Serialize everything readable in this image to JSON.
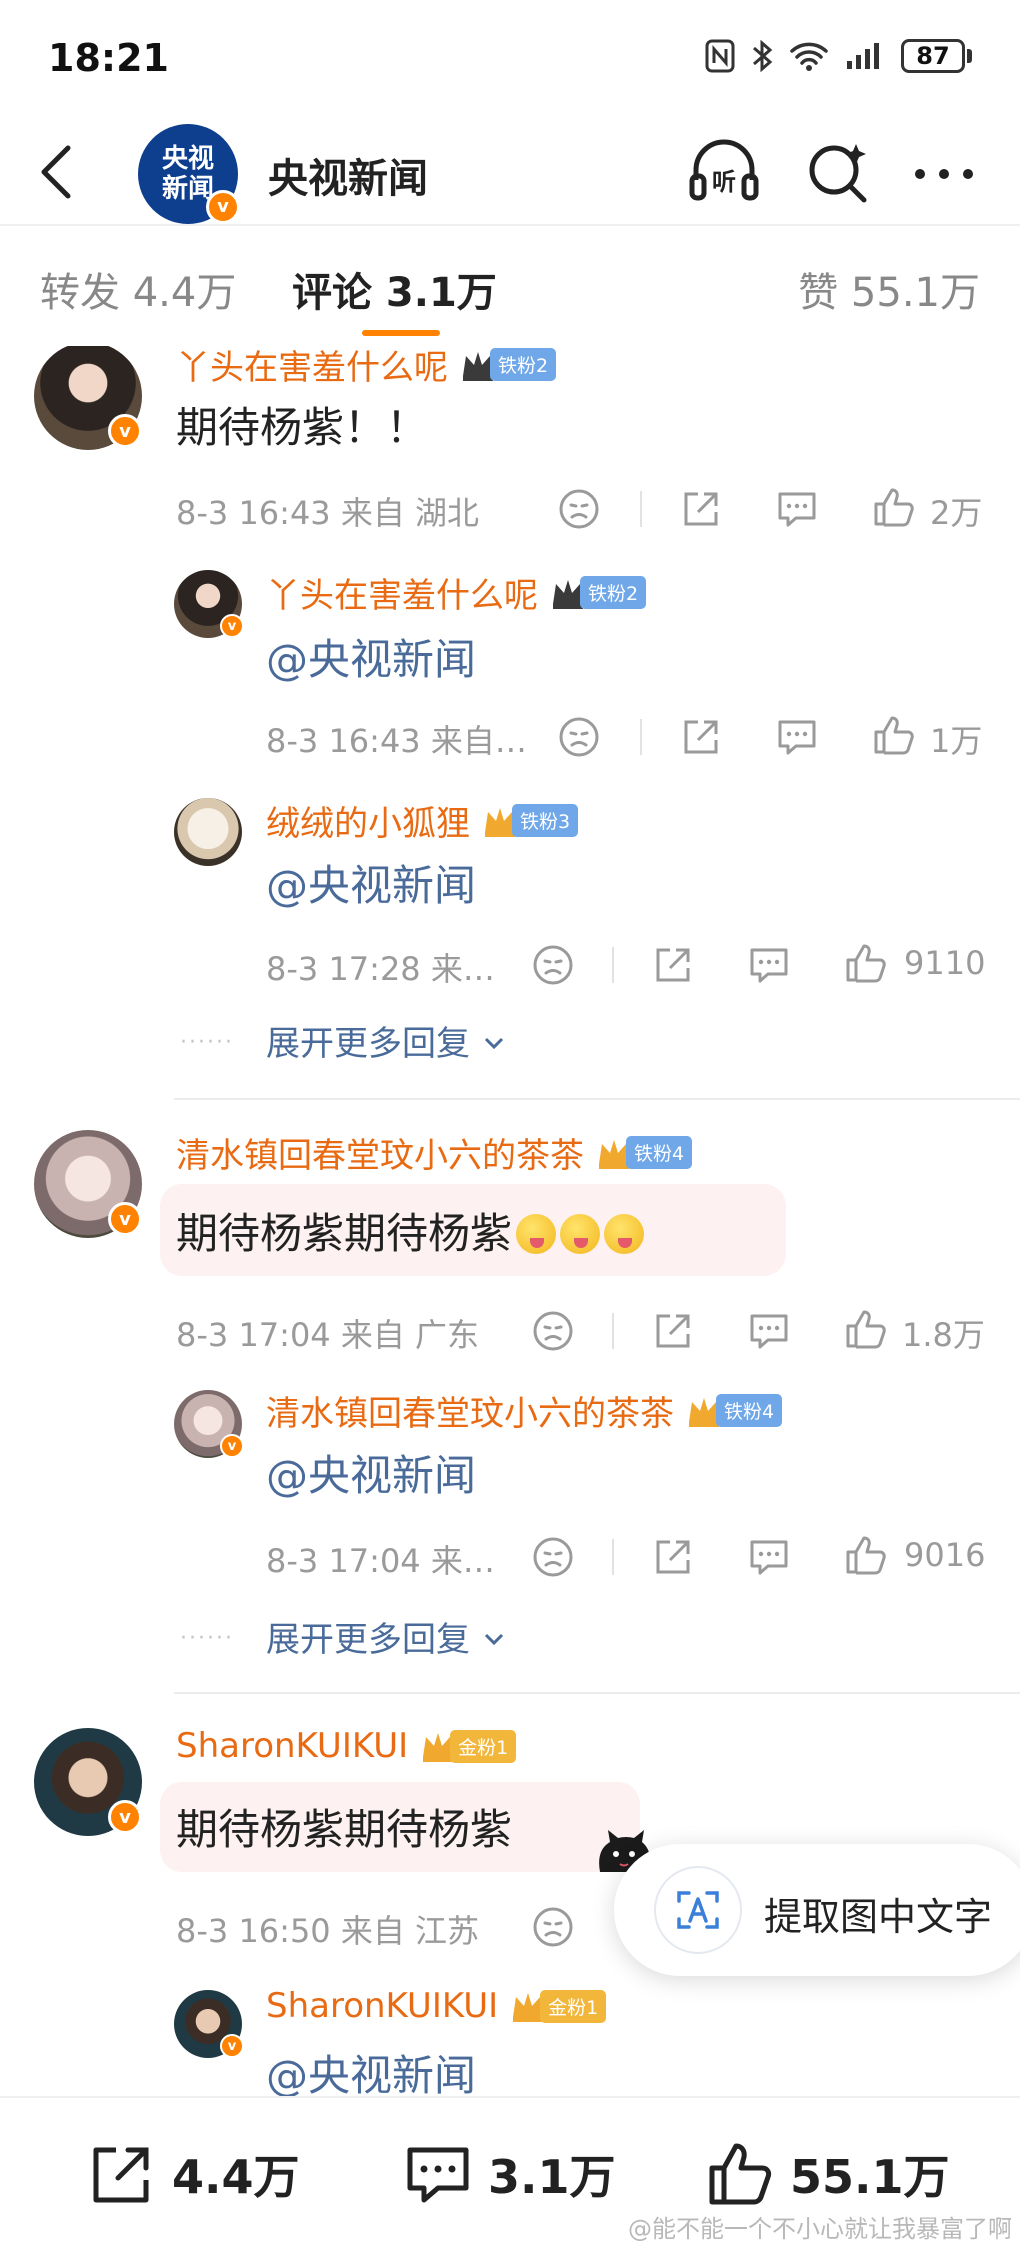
{
  "status_bar": {
    "time": "18:21",
    "battery": "87"
  },
  "nav": {
    "avatar_text_line1": "央视",
    "avatar_text_line2": "新闻",
    "title": "央视新闻",
    "listen_label": "听"
  },
  "tabs": {
    "repost": "转发 4.4万",
    "comments": "评论 3.1万",
    "likes": "赞 55.1万"
  },
  "comments": [
    {
      "username": "丫头在害羞什么呢",
      "fan_badge": "铁粉2",
      "text": "期待杨紫！！",
      "meta": "8-3 16:43 来自 湖北",
      "likes": "2万",
      "replies": [
        {
          "username": "丫头在害羞什么呢",
          "fan_badge": "铁粉2",
          "text": "@央视新闻",
          "meta": "8-3 16:43 来自…",
          "likes": "1万"
        },
        {
          "username": "绒绒的小狐狸",
          "fan_badge": "铁粉3",
          "text": "@央视新闻",
          "meta": "8-3 17:28 来…",
          "likes": "9110"
        }
      ],
      "more_replies": "展开更多回复"
    },
    {
      "username": "清水镇回春堂玟小六的茶茶",
      "fan_badge": "铁粉4",
      "text": "期待杨紫期待杨紫",
      "meta": "8-3 17:04 来自 广东",
      "likes": "1.8万",
      "replies": [
        {
          "username": "清水镇回春堂玟小六的茶茶",
          "fan_badge": "铁粉4",
          "text": "@央视新闻",
          "meta": "8-3 17:04 来…",
          "likes": "9016"
        }
      ],
      "more_replies": "展开更多回复"
    },
    {
      "username": "SharonKUIKUI",
      "fan_badge": "金粉1",
      "text": "期待杨紫期待杨紫",
      "meta": "8-3 16:50 来自 江苏",
      "replies": [
        {
          "username": "SharonKUIKUI",
          "fan_badge": "金粉1",
          "text": "@央视新闻"
        }
      ]
    }
  ],
  "extract_text_button": "提取图中文字",
  "bottom_bar": {
    "reposts": "4.4万",
    "comments": "3.1万",
    "likes": "55.1万"
  },
  "watermark": "@能不能一个不小心就让我暴富了啊",
  "colors": {
    "accent": "#ff8200",
    "username": "#e86b14",
    "mention": "#4a6b9a",
    "fan_badge": "#6fa7e8",
    "gold_badge": "#f2b63a"
  }
}
